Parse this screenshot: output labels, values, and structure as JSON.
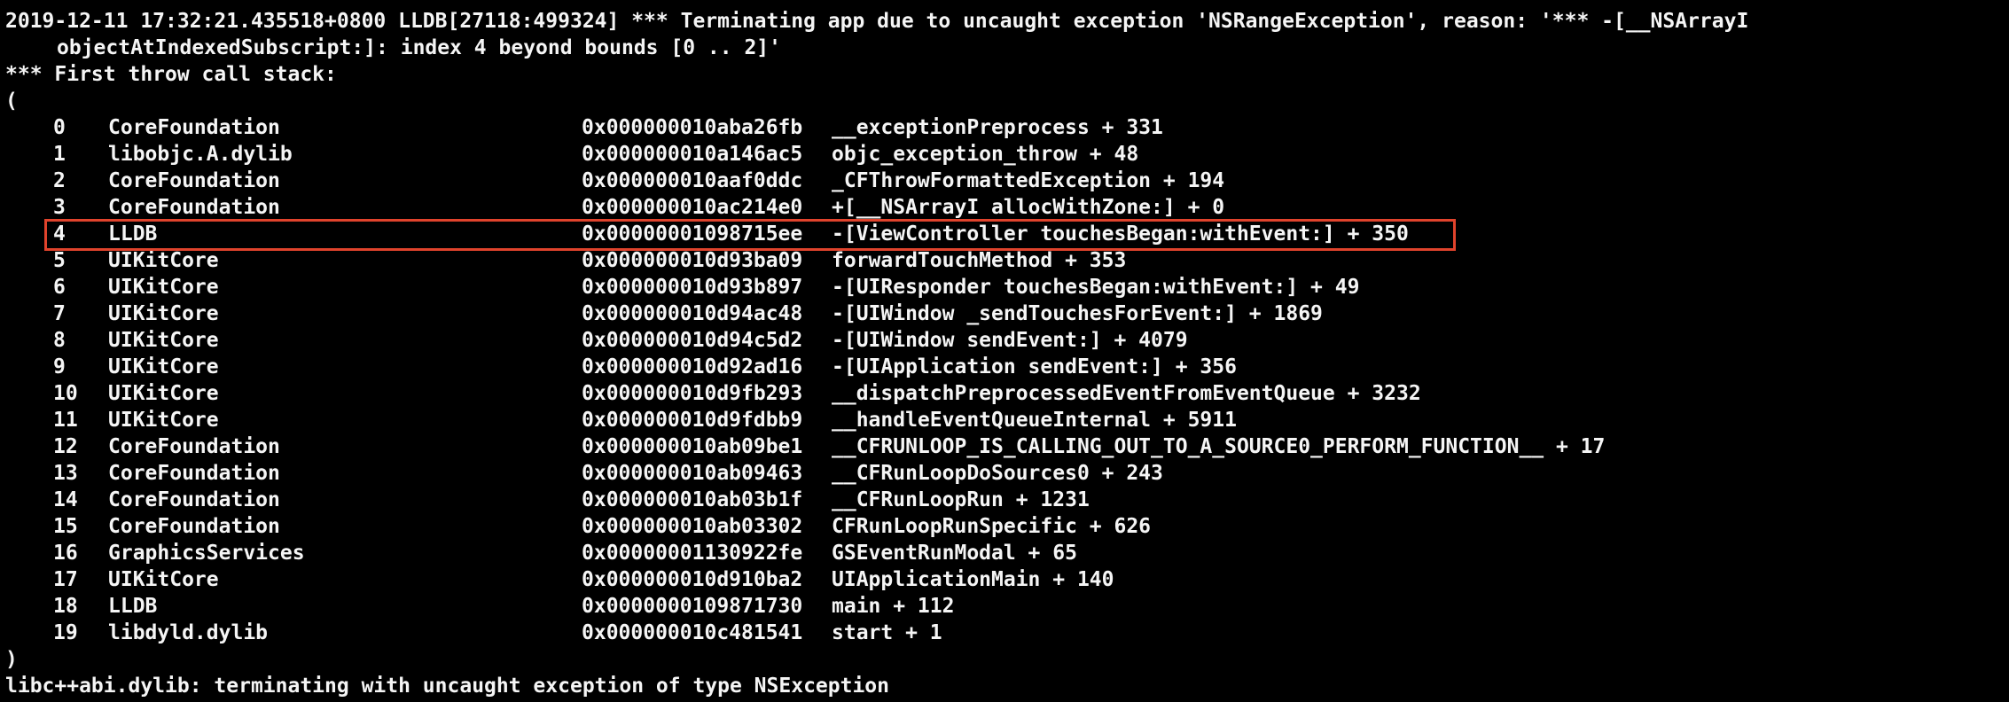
{
  "console": {
    "header_line1": "2019-12-11 17:32:21.435518+0800 LLDB[27118:499324] *** Terminating app due to uncaught exception 'NSRangeException', reason: '*** -[__NSArrayI",
    "header_line2": "objectAtIndexedSubscript:]: index 4 beyond bounds [0 .. 2]'",
    "stack_title": "*** First throw call stack:",
    "open_paren": "(",
    "frames": [
      {
        "index": "0",
        "library": "CoreFoundation",
        "address": "0x000000010aba26fb",
        "symbol": "__exceptionPreprocess + 331"
      },
      {
        "index": "1",
        "library": "libobjc.A.dylib",
        "address": "0x000000010a146ac5",
        "symbol": "objc_exception_throw + 48"
      },
      {
        "index": "2",
        "library": "CoreFoundation",
        "address": "0x000000010aaf0ddc",
        "symbol": "_CFThrowFormattedException + 194"
      },
      {
        "index": "3",
        "library": "CoreFoundation",
        "address": "0x000000010ac214e0",
        "symbol": "+[__NSArrayI allocWithZone:] + 0"
      },
      {
        "index": "4",
        "library": "LLDB",
        "address": "0x00000001098715ee",
        "symbol": "-[ViewController touchesBegan:withEvent:] + 350"
      },
      {
        "index": "5",
        "library": "UIKitCore",
        "address": "0x000000010d93ba09",
        "symbol": "forwardTouchMethod + 353"
      },
      {
        "index": "6",
        "library": "UIKitCore",
        "address": "0x000000010d93b897",
        "symbol": "-[UIResponder touchesBegan:withEvent:] + 49"
      },
      {
        "index": "7",
        "library": "UIKitCore",
        "address": "0x000000010d94ac48",
        "symbol": "-[UIWindow _sendTouchesForEvent:] + 1869"
      },
      {
        "index": "8",
        "library": "UIKitCore",
        "address": "0x000000010d94c5d2",
        "symbol": "-[UIWindow sendEvent:] + 4079"
      },
      {
        "index": "9",
        "library": "UIKitCore",
        "address": "0x000000010d92ad16",
        "symbol": "-[UIApplication sendEvent:] + 356"
      },
      {
        "index": "10",
        "library": "UIKitCore",
        "address": "0x000000010d9fb293",
        "symbol": "__dispatchPreprocessedEventFromEventQueue + 3232"
      },
      {
        "index": "11",
        "library": "UIKitCore",
        "address": "0x000000010d9fdbb9",
        "symbol": "__handleEventQueueInternal + 5911"
      },
      {
        "index": "12",
        "library": "CoreFoundation",
        "address": "0x000000010ab09be1",
        "symbol": "__CFRUNLOOP_IS_CALLING_OUT_TO_A_SOURCE0_PERFORM_FUNCTION__ + 17"
      },
      {
        "index": "13",
        "library": "CoreFoundation",
        "address": "0x000000010ab09463",
        "symbol": "__CFRunLoopDoSources0 + 243"
      },
      {
        "index": "14",
        "library": "CoreFoundation",
        "address": "0x000000010ab03b1f",
        "symbol": "__CFRunLoopRun + 1231"
      },
      {
        "index": "15",
        "library": "CoreFoundation",
        "address": "0x000000010ab03302",
        "symbol": "CFRunLoopRunSpecific + 626"
      },
      {
        "index": "16",
        "library": "GraphicsServices",
        "address": "0x00000001130922fe",
        "symbol": "GSEventRunModal + 65"
      },
      {
        "index": "17",
        "library": "UIKitCore",
        "address": "0x000000010d910ba2",
        "symbol": "UIApplicationMain + 140"
      },
      {
        "index": "18",
        "library": "LLDB",
        "address": "0x0000000109871730",
        "symbol": "main + 112"
      },
      {
        "index": "19",
        "library": "libdyld.dylib",
        "address": "0x000000010c481541",
        "symbol": "start + 1"
      }
    ],
    "close_paren": ")",
    "footer_line": "libc++abi.dylib: terminating with uncaught exception of type NSException"
  },
  "colors": {
    "background": "#000000",
    "text": "#f5f5f5",
    "highlight_border": "#e0432c"
  }
}
